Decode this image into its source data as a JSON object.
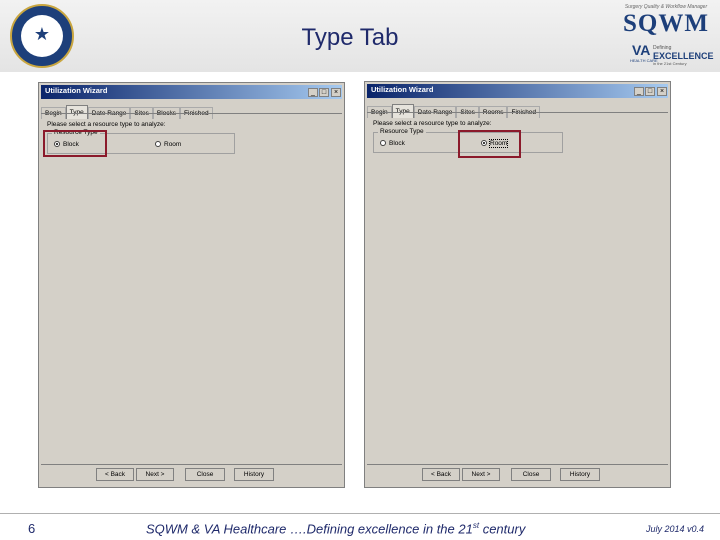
{
  "slide": {
    "title": "Type Tab",
    "page_number": "6",
    "footer_main": "SQWM & VA Healthcare ….Defining excellence in the 21",
    "footer_sup": "st",
    "footer_tail": " century",
    "version": "July 2014 v0.4"
  },
  "logo": {
    "tagline": "Surgery Quality & Workflow Manager",
    "name": "SQWM",
    "va": "VA",
    "care": "HEALTH CARE",
    "defining": "Defining",
    "excellence": "EXCELLENCE",
    "century": "in the 21st Century"
  },
  "seal": {
    "icon": "eagle-seal-icon"
  },
  "left_window": {
    "title": "Utilization Wizard",
    "controls": [
      "_",
      "□",
      "×"
    ],
    "tabs": [
      "Begin",
      "Type",
      "Date Range",
      "Sites",
      "Blocks",
      "Finished"
    ],
    "active_tab": "Type",
    "prompt": "Please select a resource type to analyze:",
    "group_label": "Resource Type",
    "option_block": "Block",
    "option_room": "Room",
    "selected": "Block",
    "buttons": [
      "< Back",
      "Next >",
      "Close",
      "History"
    ]
  },
  "right_window": {
    "title": "Utilization Wizard",
    "controls": [
      "_",
      "□",
      "×"
    ],
    "tabs": [
      "Begin",
      "Type",
      "Date Range",
      "Sites",
      "Rooms",
      "Finished"
    ],
    "active_tab": "Type",
    "prompt": "Please select a resource type to analyze:",
    "group_label": "Resource Type",
    "option_block": "Block",
    "option_room": "Room",
    "selected": "Room",
    "buttons": [
      "< Back",
      "Next >",
      "Close",
      "History"
    ]
  },
  "colors": {
    "highlight": "#8b1a2b",
    "titlebar": "#0a246a",
    "title_text": "#1f2a6b"
  }
}
